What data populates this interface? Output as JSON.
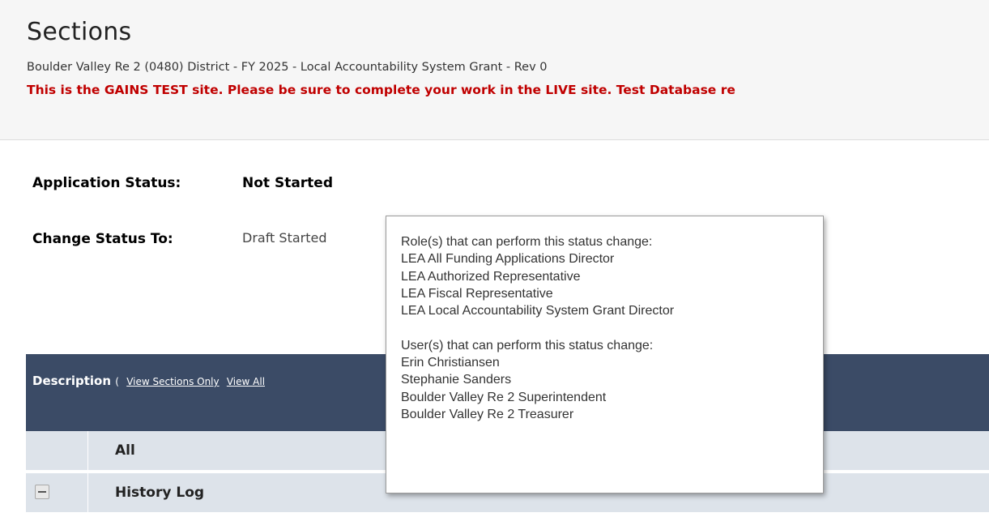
{
  "header": {
    "title": "Sections",
    "subtitle": "Boulder Valley Re 2 (0480) District - FY 2025 - Local Accountability System Grant - Rev 0",
    "test_warning": "This is the GAINS TEST site. Please be sure to complete your work in the LIVE site. Test Database re"
  },
  "status": {
    "application_status_label": "Application Status:",
    "application_status_value": "Not Started",
    "change_status_label": "Change Status To:",
    "change_status_value": "Draft Started"
  },
  "table": {
    "description_label": "Description",
    "paren_open": "(",
    "link_sections_only": "View Sections Only",
    "link_view_all": "View All",
    "rows": [
      {
        "label": "All"
      },
      {
        "label": "History Log"
      }
    ]
  },
  "tooltip": {
    "roles_heading": "Role(s) that can perform this status change:",
    "roles": [
      "LEA All Funding Applications Director",
      "LEA Authorized Representative",
      "LEA Fiscal Representative",
      "LEA Local Accountability System Grant Director"
    ],
    "users_heading": "User(s) that can perform this status change:",
    "users": [
      "Erin Christiansen",
      "Stephanie Sanders",
      "Boulder Valley Re 2 Superintendent",
      "Boulder Valley Re 2 Treasurer"
    ]
  },
  "colors": {
    "warning": "#c00000",
    "table_header_bg": "#3b4b66",
    "row_bg": "#dde3ea"
  },
  "icons": {
    "history_toggle": "collapse-minus-icon"
  }
}
